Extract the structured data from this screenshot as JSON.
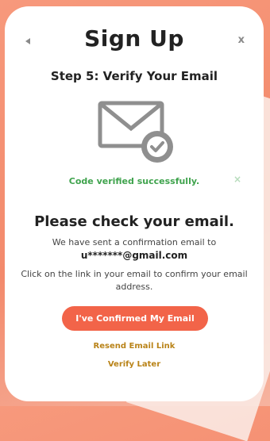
{
  "header": {
    "title": "Sign Up",
    "step": "Step 5: Verify Your Email",
    "close_label": "x"
  },
  "status": {
    "message": "Code verified successfully.",
    "close_label": "×"
  },
  "main": {
    "heading": "Please check your email.",
    "line1": "We have sent a confirmation email to",
    "email": "u*******@gmail.com",
    "line2": "Click on the link in your email to confirm your email address.",
    "confirm_label": "I've Confirmed My Email",
    "resend_label": "Resend Email Link",
    "later_label": "Verify Later"
  },
  "colors": {
    "accent": "#f26449",
    "success": "#3fa34d",
    "link": "#b98318"
  }
}
